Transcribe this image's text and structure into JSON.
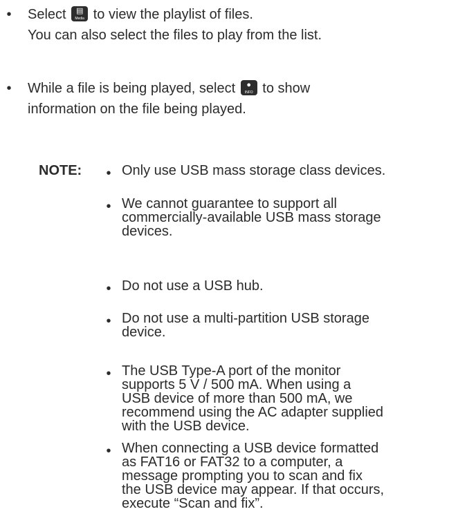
{
  "bullets": [
    {
      "marker": "•",
      "line1_before": "Select",
      "line1_after": "to view the playlist of files.",
      "line2": "You can also select the files to play from the list.",
      "icon": "playlist-icon",
      "icon_caption": "Media"
    },
    {
      "marker": "•",
      "line1_before": "While a file is being played, select",
      "line1_after": "to show",
      "line2": "information on the file being played.",
      "icon": "info-icon",
      "icon_caption": "INFO"
    }
  ],
  "note": {
    "label": "NOTE:",
    "items": [
      {
        "marker": "•",
        "lines": [
          "Only use USB mass storage class devices."
        ]
      },
      {
        "marker": "•",
        "lines": [
          "We cannot guarantee to support all",
          "commercially-available USB mass storage",
          "devices."
        ]
      },
      {
        "marker": "•",
        "lines": [
          "Do not use a USB hub."
        ]
      },
      {
        "marker": "•",
        "lines": [
          "Do not use a multi-partition USB storage",
          "device."
        ]
      },
      {
        "marker": "•",
        "lines": [
          "The USB Type-A port of the monitor",
          "supports 5 V / 500 mA. When using a",
          "USB device of more than 500 mA, we",
          "recommend using the AC adapter supplied",
          "with the USB device."
        ]
      },
      {
        "marker": "•",
        "lines": [
          "When connecting a USB device formatted",
          "as FAT16 or FAT32 to a computer, a",
          "message prompting you to scan and fix",
          "the USB device may appear. If that occurs,",
          "execute “Scan and fix”."
        ]
      }
    ]
  },
  "colors": {
    "text": "#2b2b2b",
    "icon_background": "#2d2d2d"
  }
}
